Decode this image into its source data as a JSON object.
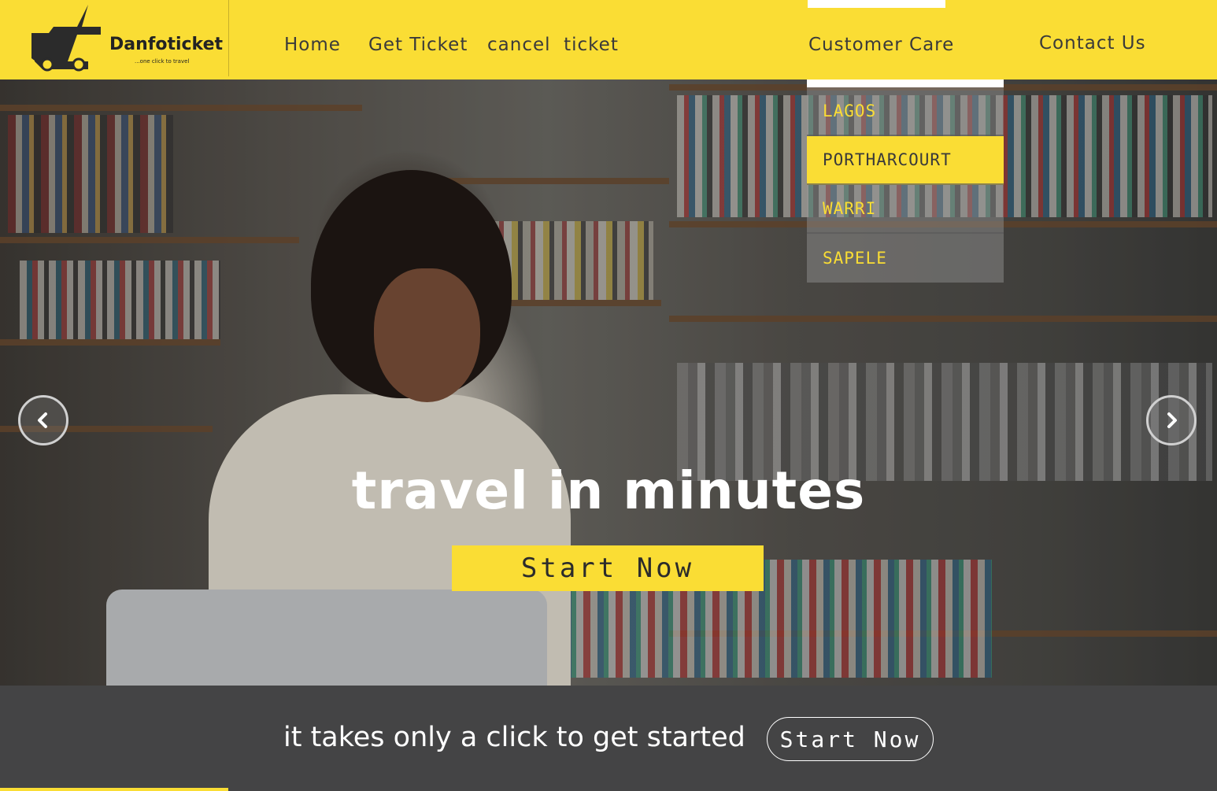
{
  "brand": {
    "name": "Danfoticket",
    "tagline": "...one click to travel"
  },
  "nav": {
    "home": "Home",
    "get_ticket": "Get Ticket",
    "cancel_ticket": "cancel  ticket",
    "customer_care": "Customer Care",
    "contact_us": "Contact Us"
  },
  "dropdown": {
    "items": [
      "LAGOS",
      "PORTHARCOURT",
      "WARRI",
      "SAPELE"
    ],
    "active_item": "PORTHARCOURT"
  },
  "hero": {
    "title": "travel in minutes",
    "cta": "Start Now",
    "prev_icon": "chevron-left-icon",
    "next_icon": "chevron-right-icon"
  },
  "bottom": {
    "text": "it takes only a click to get started",
    "cta": "Start Now"
  },
  "colors": {
    "accent": "#fadd34",
    "text_dark": "#3a3a3a",
    "bar": "#464648"
  }
}
